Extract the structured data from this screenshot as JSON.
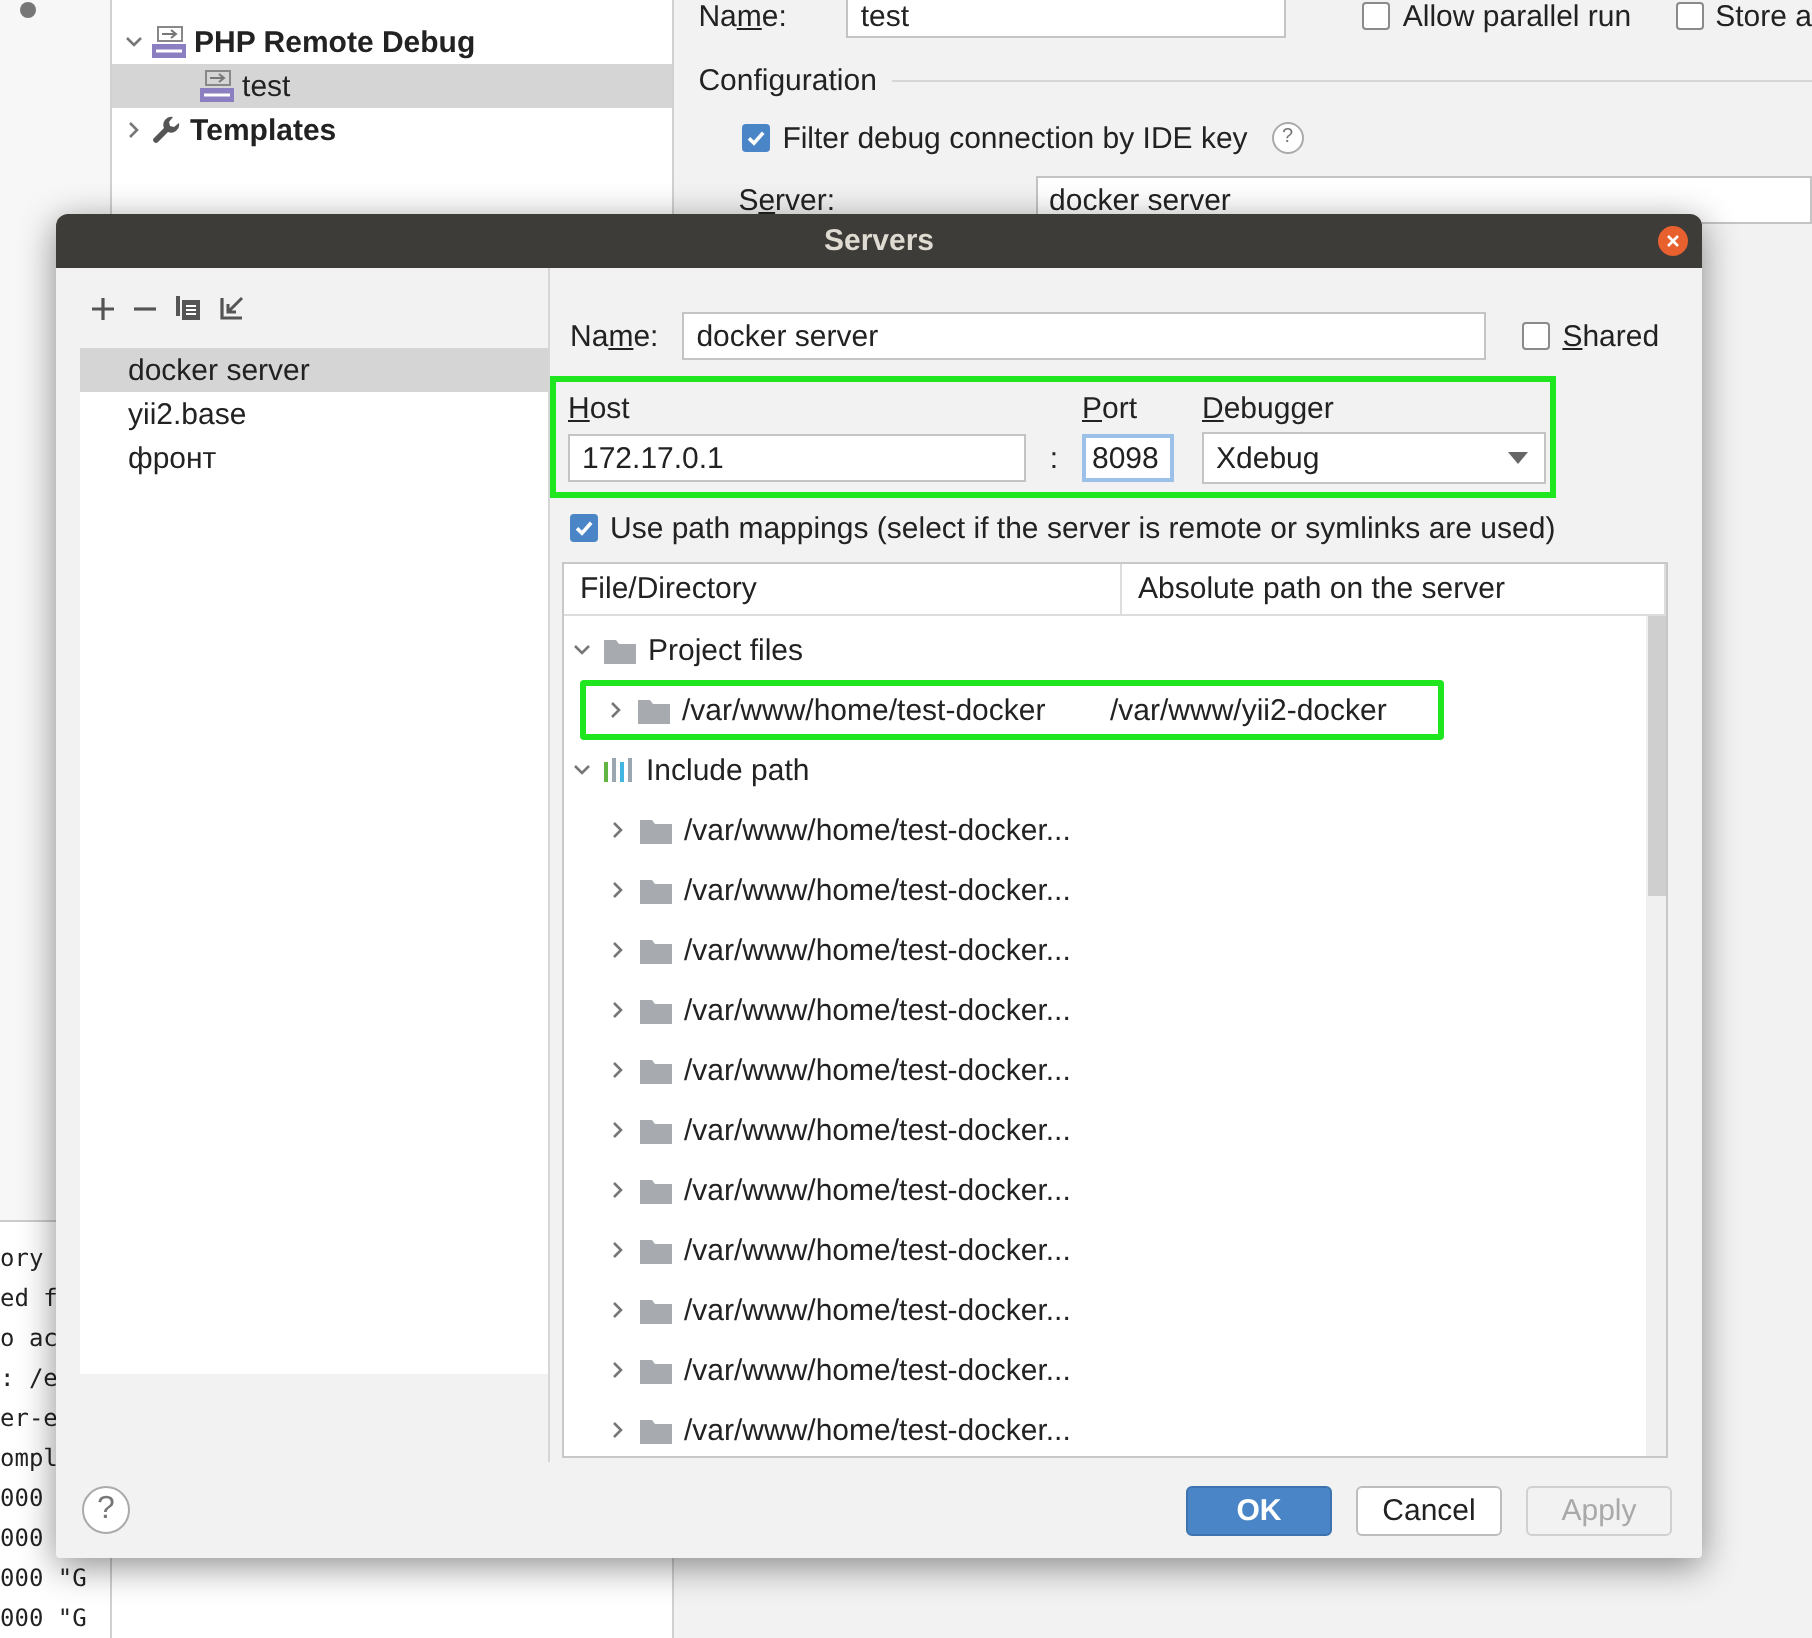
{
  "background": {
    "name_label": {
      "before": "Na",
      "key": "m",
      "after": "e:"
    },
    "name_value": "test",
    "options": [
      {
        "label": "Allow parallel run",
        "checked": false
      },
      {
        "label": "Store a",
        "checked": false
      }
    ],
    "tree": [
      {
        "label": "PHP Remote Debug",
        "kind": "php",
        "expanded": true,
        "selected": false,
        "children": [
          {
            "label": "test",
            "kind": "php",
            "selected": true
          }
        ]
      },
      {
        "label": "Templates",
        "kind": "wrench",
        "expanded": false,
        "selected": false
      }
    ],
    "section": "Configuration",
    "filter": {
      "label": "Filter debug connection by IDE key",
      "checked": true,
      "help": "?"
    },
    "server_label": {
      "before": "S",
      "key": "e",
      "after": "rver:"
    },
    "server_value": "docker server",
    "terminal_lines": [
      "ory",
      "ed f",
      "o ac",
      ": /e",
      "er-e",
      "ompl",
      "000",
      "000",
      "000 \"G",
      "000 \"G"
    ]
  },
  "dialog": {
    "title": "Servers",
    "servers": [
      {
        "label": "docker server",
        "selected": true
      },
      {
        "label": "yii2.base",
        "selected": false
      },
      {
        "label": "фронт",
        "selected": false
      }
    ],
    "name_label": {
      "before": "Na",
      "key": "m",
      "after": "e:"
    },
    "name_value": "docker server",
    "shared": {
      "label": {
        "key": "S",
        "after": "hared"
      },
      "checked": false
    },
    "connection": {
      "highlighted": true,
      "host_label": {
        "key": "H",
        "after": "ost"
      },
      "host_value": "172.17.0.1",
      "separator": ":",
      "port_label": {
        "key": "P",
        "after": "ort"
      },
      "port_value": "8098",
      "debugger_label": {
        "key": "D",
        "after": "ebugger"
      },
      "debugger_value": "Xdebug"
    },
    "path_mappings": {
      "label": "Use path mappings (select if the server is remote or symlinks are used)",
      "checked": true
    },
    "table": {
      "columns": [
        "File/Directory",
        "Absolute path on the server"
      ],
      "groups": [
        {
          "label": "Project files",
          "kind": "folder",
          "expanded": true,
          "children": [
            {
              "path": "/var/www/home/test-docker",
              "server_path": "/var/www/yii2-docker",
              "highlighted": true
            }
          ]
        },
        {
          "label": "Include path",
          "kind": "library",
          "expanded": true,
          "children": [
            {
              "path": "/var/www/home/test-docker...",
              "highlighted": false
            },
            {
              "path": "/var/www/home/test-docker...",
              "highlighted": false
            },
            {
              "path": "/var/www/home/test-docker...",
              "highlighted": false
            },
            {
              "path": "/var/www/home/test-docker...",
              "highlighted": false
            },
            {
              "path": "/var/www/home/test-docker...",
              "highlighted": false
            },
            {
              "path": "/var/www/home/test-docker...",
              "highlighted": false
            },
            {
              "path": "/var/www/home/test-docker...",
              "highlighted": false
            },
            {
              "path": "/var/www/home/test-docker...",
              "highlighted": false
            },
            {
              "path": "/var/www/home/test-docker...",
              "highlighted": false
            },
            {
              "path": "/var/www/home/test-docker...",
              "highlighted": false
            },
            {
              "path": "/var/www/home/test-docker...",
              "highlighted": false
            }
          ]
        }
      ]
    },
    "help": "?",
    "buttons": [
      {
        "label": "OK",
        "kind": "primary",
        "disabled": false
      },
      {
        "label": "Cancel",
        "kind": "normal",
        "disabled": false
      },
      {
        "label": "Apply",
        "kind": "normal",
        "disabled": true
      }
    ]
  }
}
